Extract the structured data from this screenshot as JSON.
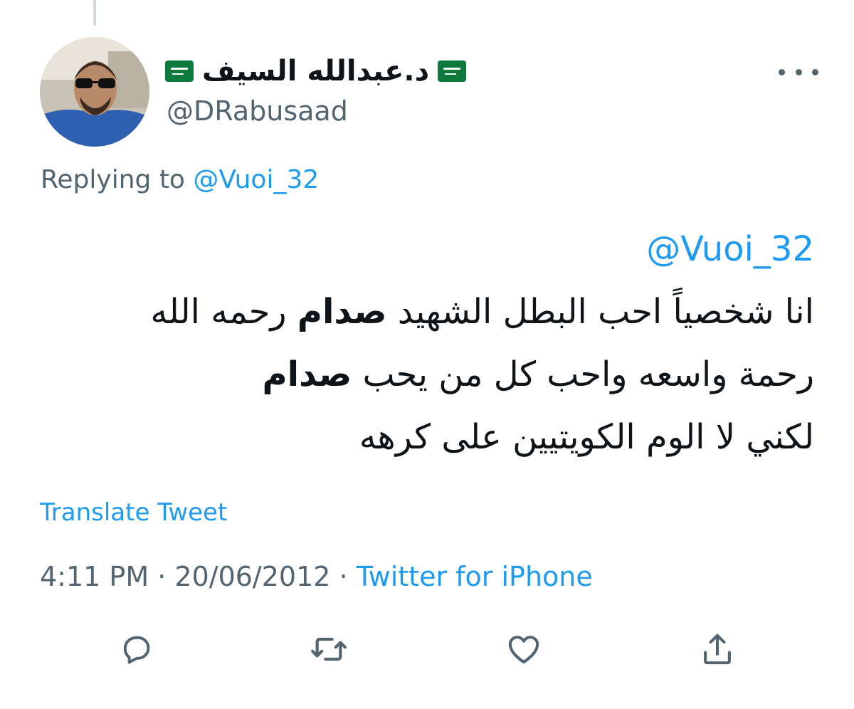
{
  "author": {
    "display_name": "د.عبدالله السيف",
    "handle": "@DRabusaad",
    "flag_icon": "saudi-flag-icon",
    "avatar": "profile-photo"
  },
  "reply": {
    "prefix": "Replying to",
    "to": "@Vuoi_32"
  },
  "tweet": {
    "mention": "@Vuoi_32",
    "line1_a": "انا شخصياً احب البطل الشهيد ",
    "line1_bold": "صدام",
    "line1_b": " رحمه الله",
    "line2_a": "رحمة واسعه واحب كل من يحب ",
    "line2_bold": "صدام",
    "line3": "لكني لا الوم الكويتيين على كرهه"
  },
  "translate_label": "Translate Tweet",
  "meta": {
    "time": "4:11 PM",
    "separator": "·",
    "date": "20/06/2012",
    "source": "Twitter for iPhone"
  },
  "actions": [
    {
      "name": "reply",
      "icon": "reply-icon"
    },
    {
      "name": "retweet",
      "icon": "retweet-icon"
    },
    {
      "name": "like",
      "icon": "like-icon"
    },
    {
      "name": "share",
      "icon": "share-icon"
    }
  ],
  "colors": {
    "link": "#1d9bf0",
    "secondary_text": "#536471",
    "primary_text": "#0f1419",
    "flag_green": "#0b7a3b"
  }
}
